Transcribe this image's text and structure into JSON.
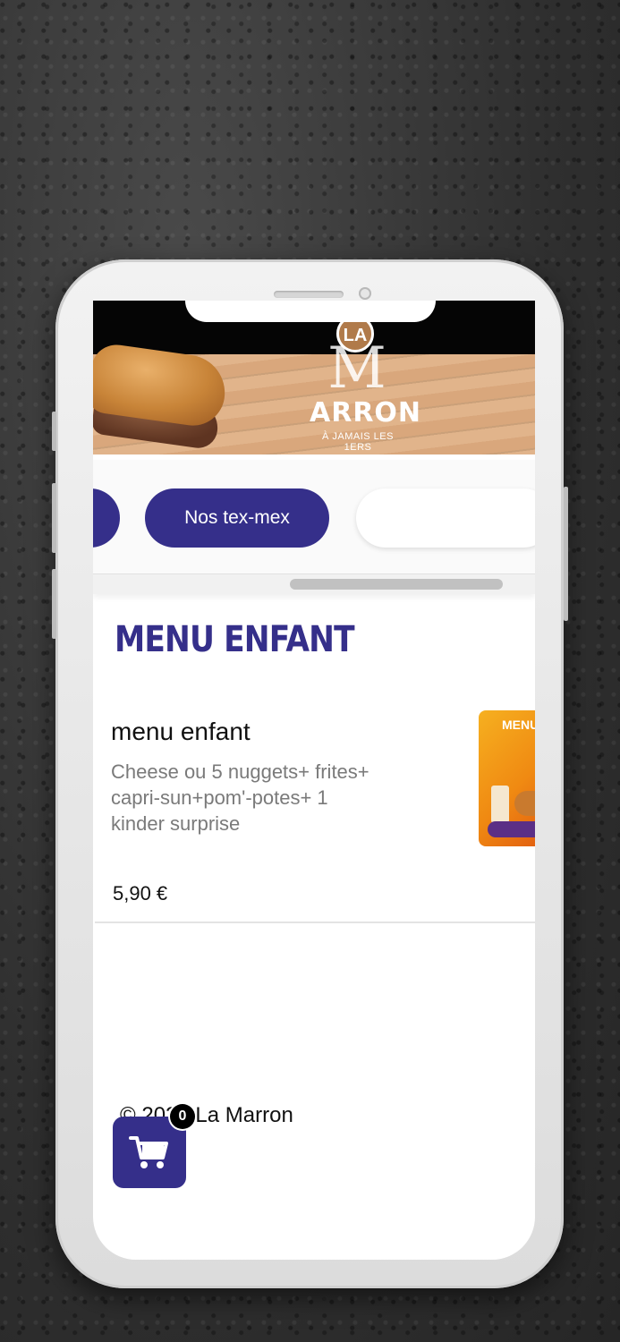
{
  "banner": {
    "logo_la": "LA",
    "logo_m": "M",
    "logo_name": "ARRON",
    "logo_tagline": "À JAMAIS LES 1ERS"
  },
  "categories": {
    "items": [
      {
        "label": ""
      },
      {
        "label": "Nos tex-mex",
        "active": true
      },
      {
        "label": ""
      }
    ],
    "accent_color": "#352f8a"
  },
  "section": {
    "title": "MENU ENFANT"
  },
  "products": [
    {
      "name": "menu enfant",
      "description": "Cheese ou 5 nuggets+ frites+ capri-sun+pom'-potes+ 1 kinder surprise",
      "price": "5,90 €",
      "image_label": "MENU"
    }
  ],
  "footer": {
    "copyright": "© 2023 La Marron"
  },
  "cart": {
    "count": "0",
    "icon": "cart-icon"
  }
}
